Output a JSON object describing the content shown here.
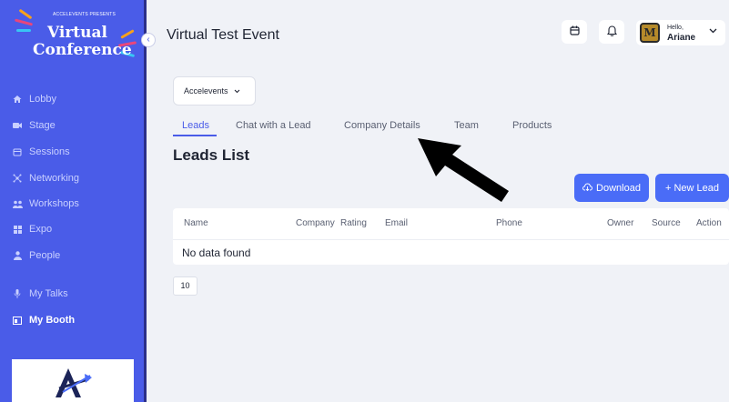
{
  "sidebar": {
    "logo": {
      "presenter": "ACCELEVENTS PRESENTS",
      "line1": "Virtual",
      "line2": "Conference"
    },
    "collapse_icon": "chevron-left-icon",
    "items": [
      {
        "label": "Lobby",
        "icon": "home-icon"
      },
      {
        "label": "Stage",
        "icon": "video-icon"
      },
      {
        "label": "Sessions",
        "icon": "calendar-icon"
      },
      {
        "label": "Networking",
        "icon": "network-icon"
      },
      {
        "label": "Workshops",
        "icon": "people-icon"
      },
      {
        "label": "Expo",
        "icon": "grid-icon"
      },
      {
        "label": "People",
        "icon": "person-icon"
      },
      {
        "label": "My Talks",
        "icon": "microphone-icon"
      },
      {
        "label": "My Booth",
        "icon": "booth-icon",
        "active": true
      }
    ],
    "sponsor_logo": "A"
  },
  "header": {
    "event_title": "Virtual Test Event",
    "calendar_icon": "calendar-icon",
    "bell_icon": "bell-icon",
    "user": {
      "greeting": "Hello,",
      "name": "Ariane",
      "avatar_letter": "M"
    }
  },
  "exhibitor_select": {
    "value": "Accelevents"
  },
  "tabs": [
    {
      "label": "Leads",
      "active": true
    },
    {
      "label": "Chat with a Lead"
    },
    {
      "label": "Company Details"
    },
    {
      "label": "Team"
    },
    {
      "label": "Products"
    }
  ],
  "page_title": "Leads List",
  "actions": {
    "download": "Download",
    "new_lead": "+ New Lead"
  },
  "table": {
    "columns": [
      "Name",
      "Company",
      "Rating",
      "Email",
      "Phone",
      "Owner",
      "Source",
      "Action"
    ],
    "empty_message": "No data found"
  },
  "pagination": {
    "page_size": "10"
  },
  "colors": {
    "sidebar": "#4a5ce8",
    "accent": "#4a6cf7",
    "background": "#f0f2f7"
  }
}
